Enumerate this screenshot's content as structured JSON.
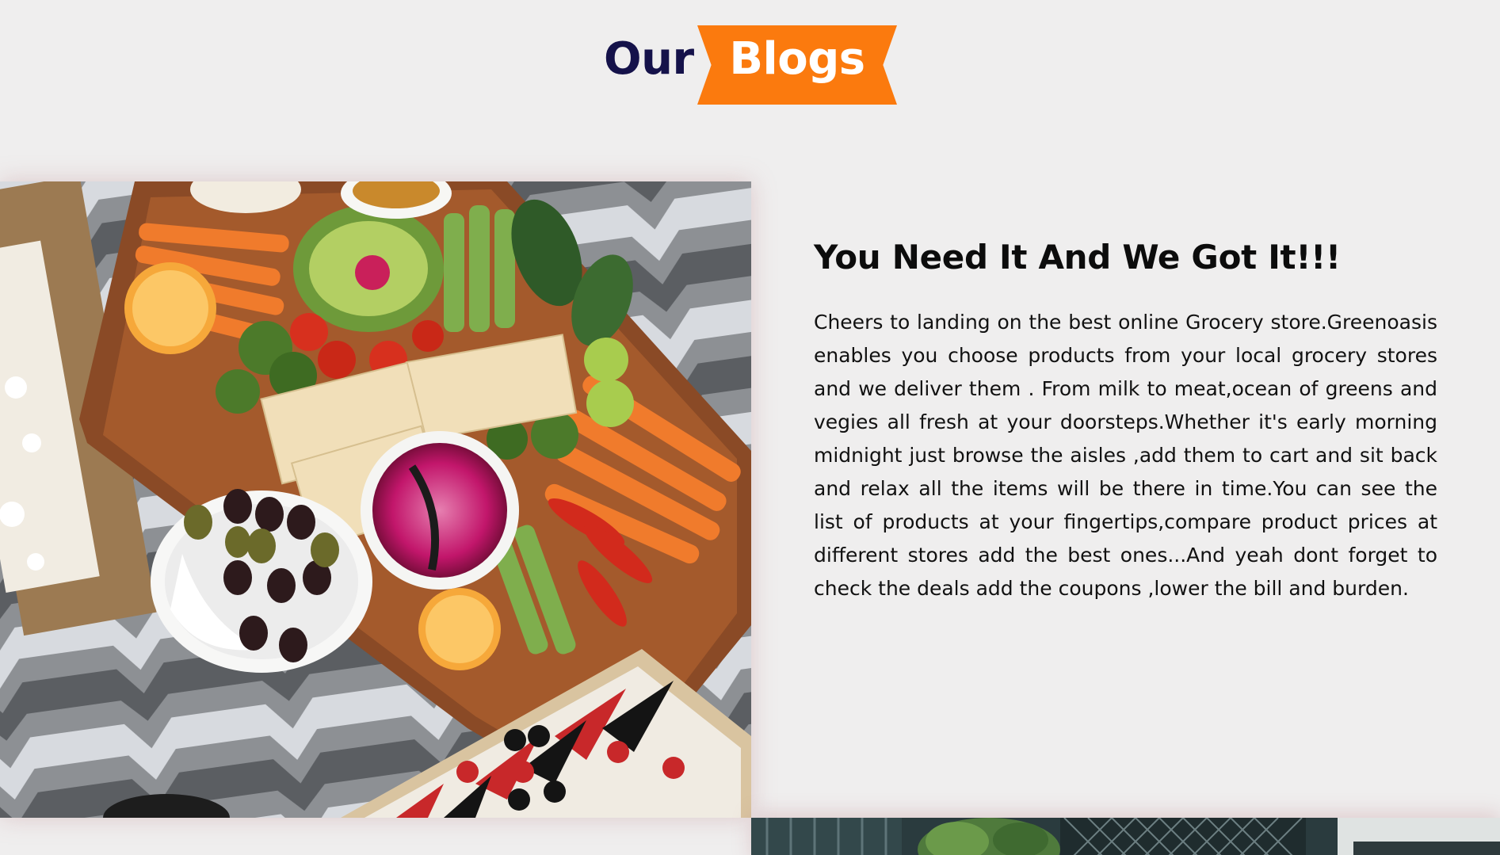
{
  "section": {
    "heading_word_1": "Our",
    "heading_word_2": "Blogs"
  },
  "blogs": [
    {
      "title": "You Need It And We Got It!!!",
      "body": "Cheers to landing on the best online Grocery store.Greenoasis enables you choose products from your local grocery stores and we deliver them . From milk to meat,ocean of greens and vegies all fresh at your doorsteps.Whether it's early morning midnight just browse the aisles ,add them to cart and sit back and relax all the items will be there in time.You can see the list of products at your fingertips,compare product prices at different stores add the best ones...And yeah dont forget to check the deals add the coupons ,lower the bill and burden.",
      "image_icon": "food-platter-photo"
    },
    {
      "image_icon": "greens-market-photo"
    }
  ],
  "colors": {
    "accent": "#fb7a0e",
    "heading": "#15124a",
    "background": "#efeeee"
  }
}
